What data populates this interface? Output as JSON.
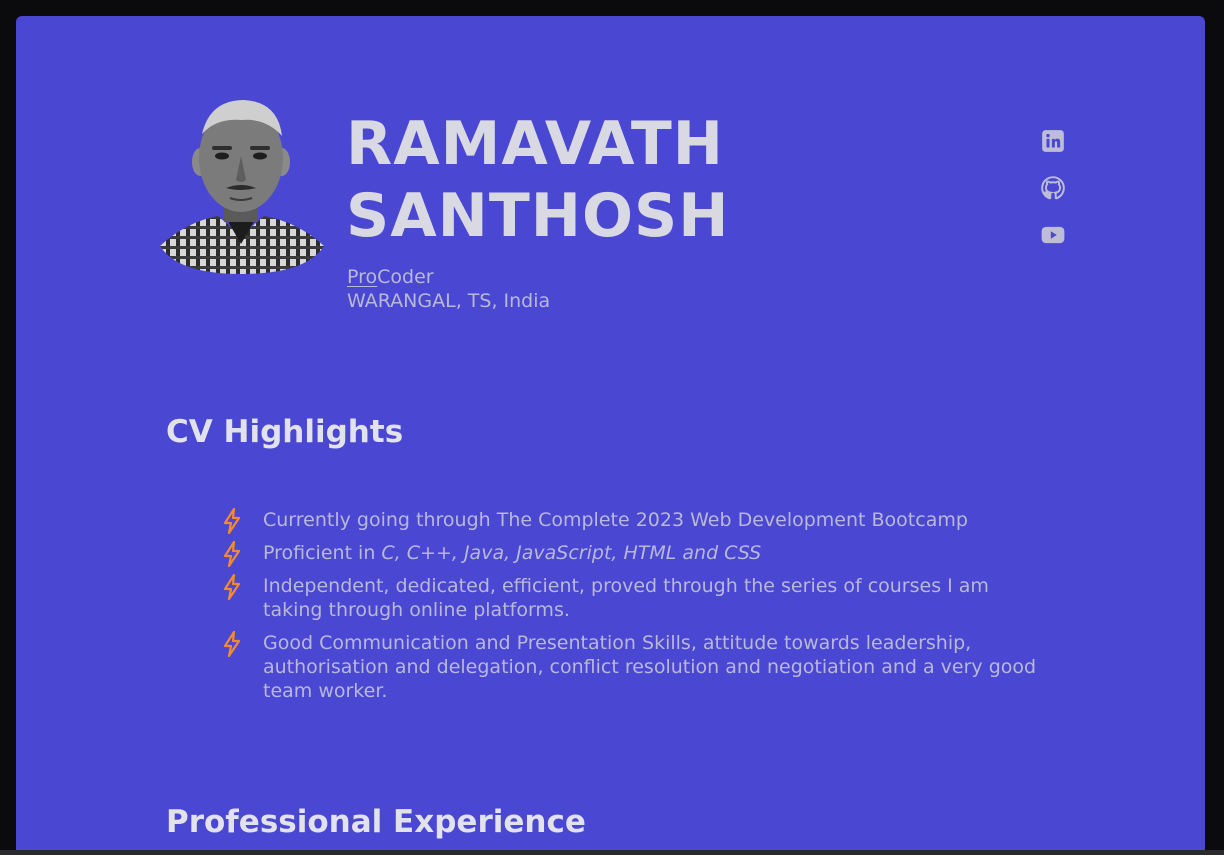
{
  "profile": {
    "first_name": "RAMAVATH",
    "last_name": "SANTHOSH",
    "role_pro": "Pro",
    "role_rest": "Coder",
    "location": "WARANGAL, TS, India"
  },
  "social": {
    "icons": [
      "linkedin-icon",
      "github-icon",
      "youtube-icon"
    ],
    "color": "#bdbdd6"
  },
  "highlights": {
    "title": "CV Highlights",
    "items": [
      {
        "text": "Currently going through The Complete 2023 Web Development Bootcamp",
        "emph": ""
      },
      {
        "text": "Proficient in ",
        "emph": "C, C++, Java, JavaScript, HTML and CSS"
      },
      {
        "text": "Independent, dedicated, efficient, proved through the series of courses I am taking through online platforms.",
        "emph": ""
      },
      {
        "text": "Good Communication and Presentation Skills, attitude towards leadership, authorisation and delegation, conflict resolution and negotiation and a very good team worker.",
        "emph": ""
      }
    ],
    "bullet_color": "#f5892f"
  },
  "experience": {
    "title": "Professional Experience"
  },
  "colors": {
    "background": "#4a47d2",
    "text": "#b9b8d8",
    "heading": "#e2e2ec"
  }
}
